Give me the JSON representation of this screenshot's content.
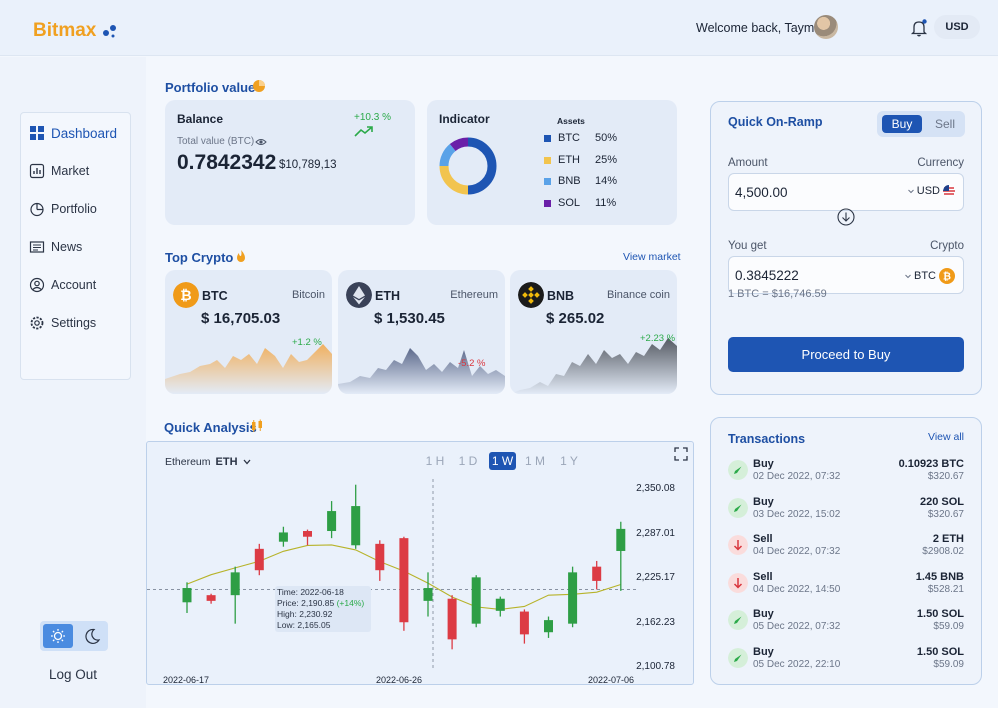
{
  "brand": {
    "name": "Bitmax"
  },
  "header": {
    "welcome": "Welcome back, Taymar",
    "currency": "USD"
  },
  "sidebar": {
    "items": [
      {
        "label": "Dashboard",
        "icon": "dashboard-icon",
        "active": true
      },
      {
        "label": "Market",
        "icon": "market-icon"
      },
      {
        "label": "Portfolio",
        "icon": "portfolio-icon"
      },
      {
        "label": "News",
        "icon": "news-icon"
      },
      {
        "label": "Account",
        "icon": "account-icon"
      },
      {
        "label": "Settings",
        "icon": "settings-icon"
      }
    ],
    "logout": "Log Out"
  },
  "portfolio": {
    "title": "Portfolio value",
    "balance": {
      "title": "Balance",
      "change": "+10.3 %",
      "subtitle": "Total value (BTC)",
      "value": "0.7842342",
      "usd": "$10,789,13"
    },
    "indicator": {
      "title": "Indicator",
      "assets_title": "Assets",
      "assets": [
        {
          "name": "BTC",
          "pct": "50%",
          "value": 50,
          "color": "#1e55b3"
        },
        {
          "name": "ETH",
          "pct": "25%",
          "value": 25,
          "color": "#f2c44e"
        },
        {
          "name": "BNB",
          "pct": "14%",
          "value": 14,
          "color": "#5aa2e8"
        },
        {
          "name": "SOL",
          "pct": "11%",
          "value": 11,
          "color": "#6a1fa8"
        }
      ]
    }
  },
  "top_crypto": {
    "title": "Top Crypto",
    "view_market": "View market",
    "cards": [
      {
        "symbol": "BTC",
        "name": "Bitcoin",
        "price": "$ 16,705.03",
        "change": "+1.2 %",
        "change_color": "#2caa4a",
        "icon": "bitcoin-icon",
        "color": "#f09a18"
      },
      {
        "symbol": "ETH",
        "name": "Ethereum",
        "price": "$ 1,530.45",
        "change": "-5.2 %",
        "change_color": "#d9363e",
        "icon": "ethereum-icon",
        "color": "#3a4258"
      },
      {
        "symbol": "BNB",
        "name": "Binance coin",
        "price": "$ 265.02",
        "change": "+2.23 %",
        "change_color": "#2caa4a",
        "icon": "binance-icon",
        "color": "#1b1b1b"
      }
    ]
  },
  "analysis": {
    "title": "Quick Analysis",
    "asset_label": "Ethereum",
    "asset_symbol": "ETH",
    "timeframes": [
      {
        "label": "1 H"
      },
      {
        "label": "1 D"
      },
      {
        "label": "1 W",
        "active": true
      },
      {
        "label": "1 M"
      },
      {
        "label": "1 Y"
      }
    ],
    "tooltip": {
      "time_label": "Time:",
      "time": "2022-06-18",
      "price_label": "Price:",
      "price": "2,190.85",
      "price_change": "(+14%)",
      "high_label": "High:",
      "high": "2,230.92",
      "low_label": "Low:",
      "low": "2,165.05"
    }
  },
  "chart_data": {
    "type": "candlestick",
    "title": "",
    "x_ticks": [
      "2022-06-17",
      "2022-06-26",
      "2022-07-06"
    ],
    "y_ticks": [
      2100.78,
      2162.23,
      2225.17,
      2287.01,
      2350.08
    ],
    "ylim": [
      2095,
      2370
    ],
    "candles": [
      {
        "o": 2190,
        "c": 2210,
        "h": 2218,
        "l": 2175
      },
      {
        "o": 2200,
        "c": 2192,
        "h": 2202,
        "l": 2188
      },
      {
        "o": 2200,
        "c": 2232,
        "h": 2240,
        "l": 2160
      },
      {
        "o": 2265,
        "c": 2235,
        "h": 2272,
        "l": 2228
      },
      {
        "o": 2275,
        "c": 2288,
        "h": 2296,
        "l": 2268
      },
      {
        "o": 2290,
        "c": 2282,
        "h": 2292,
        "l": 2270
      },
      {
        "o": 2290,
        "c": 2318,
        "h": 2332,
        "l": 2280
      },
      {
        "o": 2270,
        "c": 2325,
        "h": 2355,
        "l": 2265
      },
      {
        "o": 2272,
        "c": 2235,
        "h": 2277,
        "l": 2220
      },
      {
        "o": 2280,
        "c": 2162,
        "h": 2282,
        "l": 2150
      },
      {
        "o": 2192,
        "c": 2210,
        "h": 2232,
        "l": 2170
      },
      {
        "o": 2195,
        "c": 2138,
        "h": 2200,
        "l": 2124
      },
      {
        "o": 2160,
        "c": 2225,
        "h": 2228,
        "l": 2155
      },
      {
        "o": 2178,
        "c": 2195,
        "h": 2198,
        "l": 2170
      },
      {
        "o": 2177,
        "c": 2145,
        "h": 2180,
        "l": 2132
      },
      {
        "o": 2148,
        "c": 2165,
        "h": 2170,
        "l": 2140
      },
      {
        "o": 2160,
        "c": 2232,
        "h": 2240,
        "l": 2155
      },
      {
        "o": 2240,
        "c": 2220,
        "h": 2248,
        "l": 2208
      },
      {
        "o": 2262,
        "c": 2293,
        "h": 2303,
        "l": 2206
      }
    ],
    "grid": false
  },
  "onramp": {
    "title": "Quick On-Ramp",
    "buy": "Buy",
    "sell": "Sell",
    "amount_label": "Amount",
    "currency_label": "Currency",
    "amount": "4,500.00",
    "amount_currency": "USD",
    "get_label": "You get",
    "crypto_label": "Crypto",
    "get_value": "0.3845222",
    "get_currency": "BTC",
    "rate": "1 BTC = $16,746.59",
    "proceed": "Proceed to Buy"
  },
  "transactions": {
    "title": "Transactions",
    "view_all": "View all",
    "items": [
      {
        "type": "Buy",
        "date": "02 Dec 2022, 07:32",
        "amount": "0.10923 BTC",
        "usd": "$320.67"
      },
      {
        "type": "Buy",
        "date": "03 Dec 2022, 15:02",
        "amount": "220 SOL",
        "usd": "$320.67"
      },
      {
        "type": "Sell",
        "date": "04 Dec 2022, 07:32",
        "amount": "2 ETH",
        "usd": "$2908.02"
      },
      {
        "type": "Sell",
        "date": "04 Dec 2022, 14:50",
        "amount": "1.45 BNB",
        "usd": "$528.21"
      },
      {
        "type": "Buy",
        "date": "05 Dec 2022, 07:32",
        "amount": "1.50 SOL",
        "usd": "$59.09"
      },
      {
        "type": "Buy",
        "date": "05 Dec 2022, 22:10",
        "amount": "1.50 SOL",
        "usd": "$59.09"
      }
    ]
  }
}
